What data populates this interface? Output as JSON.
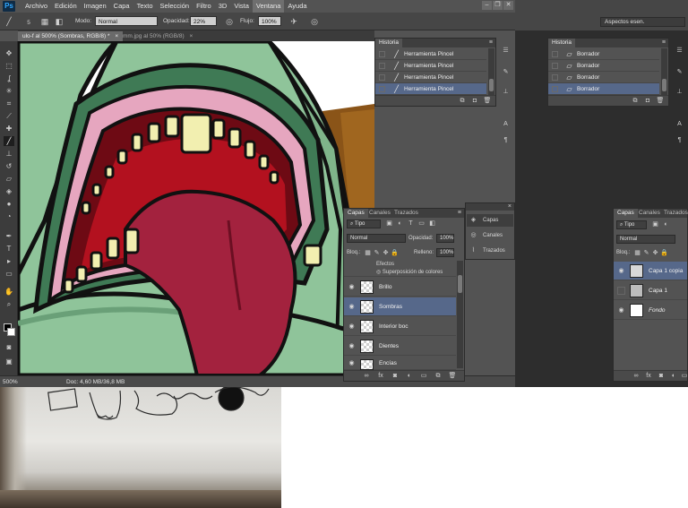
{
  "app": {
    "logo": "Ps"
  },
  "menu": [
    "Archivo",
    "Edición",
    "Imagen",
    "Capa",
    "Texto",
    "Selección",
    "Filtro",
    "3D",
    "Vista",
    "Ventana",
    "Ayuda"
  ],
  "window_controls": {
    "minimize": "–",
    "restore": "❐",
    "close": "✕"
  },
  "options": {
    "brush_size": "5",
    "mode_label": "Modo:",
    "mode_value": "Normal",
    "opacity_label": "Opacidad:",
    "opacity_value": "22%",
    "flow_label": "Flujo:",
    "flow_value": "100%",
    "workspace": "Aspectos esen."
  },
  "doc_tabs": [
    {
      "label": "ulo-f al 500% (Sombras, RGB/8) *",
      "close": "×"
    },
    {
      "label": "mm.jpg al 50% (RGB/8)",
      "close": "×"
    }
  ],
  "status": {
    "zoom": "500%",
    "doc": "Doc: 4,60 MB/36,8 MB"
  },
  "history_left": {
    "title": "Historia",
    "items": [
      "Herramienta Pincel",
      "Herramienta Pincel",
      "Herramienta Pincel",
      "Herramienta Pincel"
    ]
  },
  "history_right": {
    "title": "Historia",
    "items": [
      "Borrador",
      "Borrador",
      "Borrador",
      "Borrador"
    ]
  },
  "layers_left": {
    "tabs": [
      "Capas",
      "Canales",
      "Trazados"
    ],
    "filter": "Tipo",
    "blend": "Normal",
    "opacity_label": "Opacidad:",
    "opacity": "100%",
    "lock_label": "Bloq.:",
    "fill_label": "Relleno:",
    "fill": "100%",
    "effects_label": "Efectos",
    "effect_item": "Superposición de colores",
    "layers": [
      "Brillo",
      "Sombras",
      "Interior boc",
      "Dientes",
      "Encías"
    ]
  },
  "mini_panel": {
    "items": [
      "Capas",
      "Canales",
      "Trazados"
    ]
  },
  "layers_right": {
    "tabs": [
      "Capas",
      "Canales",
      "Trazados"
    ],
    "filter": "Tipo",
    "blend": "Normal",
    "lock_label": "Bloq.:",
    "layers": [
      "Capa 1 copia",
      "Capa 1",
      "Fondo"
    ]
  },
  "colors": {
    "accent": "#31a8ff",
    "selection": "#56688a",
    "panel": "#535353"
  }
}
